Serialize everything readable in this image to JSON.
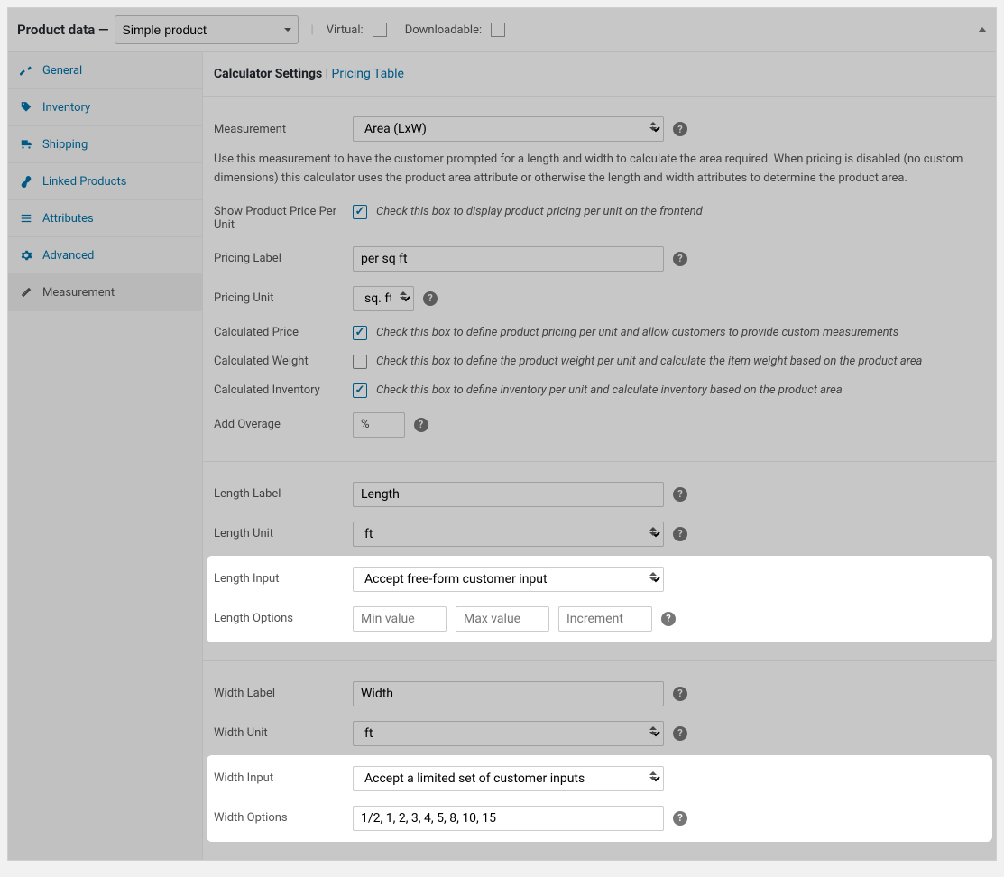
{
  "header": {
    "title": "Product data —",
    "product_type": "Simple product",
    "virtual_label": "Virtual:",
    "downloadable_label": "Downloadable:"
  },
  "sidebar": {
    "items": [
      {
        "label": "General"
      },
      {
        "label": "Inventory"
      },
      {
        "label": "Shipping"
      },
      {
        "label": "Linked Products"
      },
      {
        "label": "Attributes"
      },
      {
        "label": "Advanced"
      },
      {
        "label": "Measurement"
      }
    ]
  },
  "content": {
    "head": {
      "title": "Calculator Settings",
      "sep": " | ",
      "link": "Pricing Table"
    },
    "measurement": {
      "label": "Measurement",
      "value": "Area (LxW)",
      "desc": "Use this measurement to have the customer prompted for a length and width to calculate the area required. When pricing is disabled (no custom dimensions) this calculator uses the product area attribute or otherwise the length and width attributes to determine the product area."
    },
    "show_price_per_unit": {
      "label": "Show Product Price Per Unit",
      "desc": "Check this box to display product pricing per unit on the frontend"
    },
    "pricing_label": {
      "label": "Pricing Label",
      "value": "per sq ft"
    },
    "pricing_unit": {
      "label": "Pricing Unit",
      "value": "sq. ft."
    },
    "calculated_price": {
      "label": "Calculated Price",
      "desc": "Check this box to define product pricing per unit and allow customers to provide custom measurements"
    },
    "calculated_weight": {
      "label": "Calculated Weight",
      "desc": "Check this box to define the product weight per unit and calculate the item weight based on the product area"
    },
    "calculated_inventory": {
      "label": "Calculated Inventory",
      "desc": "Check this box to define inventory per unit and calculate inventory based on the product area"
    },
    "add_overage": {
      "label": "Add Overage",
      "symbol": "%"
    },
    "length_label": {
      "label": "Length Label",
      "value": "Length"
    },
    "length_unit": {
      "label": "Length Unit",
      "value": "ft"
    },
    "length_input": {
      "label": "Length Input",
      "value": "Accept free-form customer input"
    },
    "length_options": {
      "label": "Length Options",
      "min_ph": "Min value",
      "max_ph": "Max value",
      "inc_ph": "Increment"
    },
    "width_label": {
      "label": "Width Label",
      "value": "Width"
    },
    "width_unit": {
      "label": "Width Unit",
      "value": "ft"
    },
    "width_input": {
      "label": "Width Input",
      "value": "Accept a limited set of customer inputs"
    },
    "width_options": {
      "label": "Width Options",
      "value": "1/2, 1, 2, 3, 4, 5, 8, 10, 15"
    }
  },
  "help_glyph": "?"
}
